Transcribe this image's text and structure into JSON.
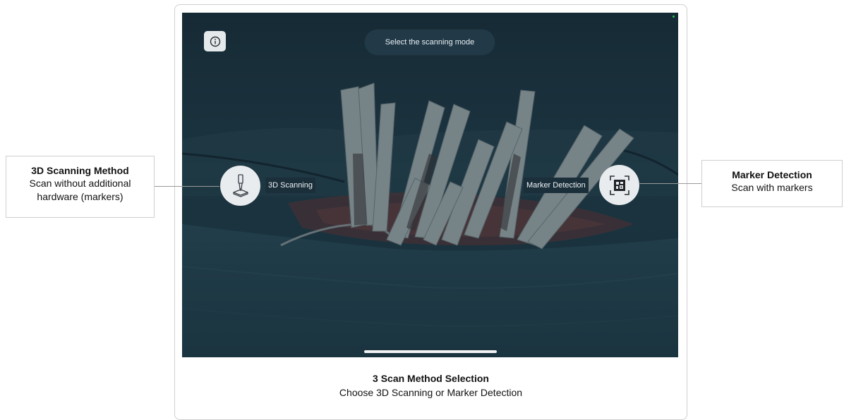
{
  "screen": {
    "prompt": "Select the scanning mode",
    "info_icon": "info-icon",
    "modes": {
      "scan3d": {
        "label": "3D Scanning",
        "icon": "scanner-tool-icon"
      },
      "marker": {
        "label": "Marker Detection",
        "icon": "marker-qr-icon"
      }
    }
  },
  "callouts": {
    "left": {
      "title": "3D Scanning Method",
      "line1": "Scan without additional",
      "line2": "hardware (markers)"
    },
    "right": {
      "title": "Marker Detection",
      "line1": "Scan with markers"
    }
  },
  "caption": {
    "title": "3 Scan Method Selection",
    "description": "Choose 3D Scanning or Marker Detection"
  },
  "colors": {
    "screen_bg": "#1f3a48",
    "circle_bg": "#e9ecef",
    "retractor": "#d4d8d8",
    "drape": "#2b4a5a"
  }
}
